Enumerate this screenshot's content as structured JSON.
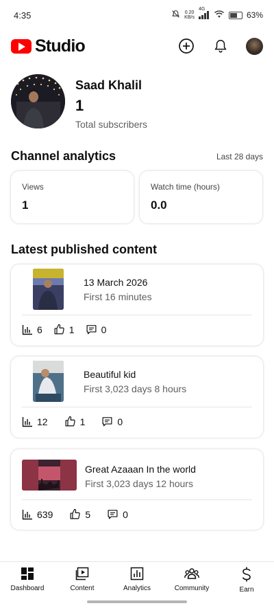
{
  "status_bar": {
    "time": "4:35",
    "net_rate_value": "0.20",
    "net_rate_unit": "KB/s",
    "net_type": "4G",
    "battery": "63%",
    "battery_level": 0.63
  },
  "header": {
    "logo_text": "Studio",
    "icons": [
      "create-icon",
      "bell-icon",
      "account-avatar"
    ],
    "accent_color": "#ff0000"
  },
  "profile": {
    "name": "Saad Khalil",
    "subscribers": "1",
    "subscribers_label": "Total subscribers"
  },
  "analytics": {
    "title": "Channel analytics",
    "period": "Last 28 days",
    "cards": [
      {
        "label": "Views",
        "value": "1"
      },
      {
        "label": "Watch time (hours)",
        "value": "0.0"
      }
    ]
  },
  "latest": {
    "title": "Latest published content",
    "items": [
      {
        "title": "13 March 2026",
        "subtitle": "First 16 minutes",
        "views": "6",
        "likes": "1",
        "comments": "0"
      },
      {
        "title": "Beautiful kid",
        "subtitle": "First 3,023 days 8 hours",
        "views": "12",
        "likes": "1",
        "comments": "0"
      },
      {
        "title": "Great Azaaan In the world",
        "subtitle": "First 3,023 days 12 hours",
        "views": "639",
        "likes": "5",
        "comments": "0"
      }
    ]
  },
  "bottom_nav": {
    "items": [
      {
        "label": "Dashboard",
        "icon": "dashboard-icon",
        "active": true
      },
      {
        "label": "Content",
        "icon": "content-icon",
        "active": false
      },
      {
        "label": "Analytics",
        "icon": "analytics-icon",
        "active": false
      },
      {
        "label": "Community",
        "icon": "community-icon",
        "active": false
      },
      {
        "label": "Earn",
        "icon": "earn-icon",
        "active": false
      }
    ]
  }
}
